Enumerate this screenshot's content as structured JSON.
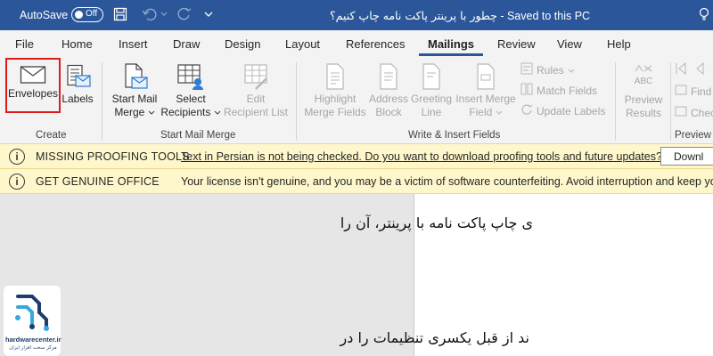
{
  "titlebar": {
    "autosave_label": "AutoSave",
    "autosave_state": "Off",
    "document_title": "چطور با پرینتر پاکت نامه چاپ کنیم؟",
    "separator": " - ",
    "save_status": "Saved to this PC",
    "bg_color": "#2b579a"
  },
  "tabs": [
    "File",
    "Home",
    "Insert",
    "Draw",
    "Design",
    "Layout",
    "References",
    "Mailings",
    "Review",
    "View",
    "Help"
  ],
  "active_tab": "Mailings",
  "ribbon": {
    "create": {
      "envelopes": "Envelopes",
      "labels": "Labels",
      "group": "Create"
    },
    "start_mail_merge": {
      "start_mail_merge_l1": "Start Mail",
      "start_mail_merge_l2": "Merge",
      "select_recipients_l1": "Select",
      "select_recipients_l2": "Recipients",
      "edit_recipient_list_l1": "Edit",
      "edit_recipient_list_l2": "Recipient List",
      "group": "Start Mail Merge"
    },
    "write_insert": {
      "highlight_l1": "Highlight",
      "highlight_l2": "Merge Fields",
      "address_l1": "Address",
      "address_l2": "Block",
      "greeting_l1": "Greeting",
      "greeting_l2": "Line",
      "insert_merge_l1": "Insert Merge",
      "insert_merge_l2": "Field",
      "rules": "Rules",
      "match_fields": "Match Fields",
      "update_labels": "Update Labels",
      "group": "Write & Insert Fields"
    },
    "preview": {
      "preview_results_icon_text": "ABC",
      "preview_l1": "Preview",
      "preview_l2": "Results",
      "find": "Find",
      "check": "Chec",
      "group": "Preview"
    },
    "highlight_color": "#e11a1a"
  },
  "messages": [
    {
      "title": "MISSING PROOFING TOOLS",
      "text": "Text in Persian is not being checked. Do you want to download proofing tools and future updates?",
      "button": "Downl"
    },
    {
      "title": "GET GENUINE OFFICE",
      "text": "Your license isn't genuine, and you may be a victim of software counterfeiting. Avoid interruption and keep your f"
    }
  ],
  "document": {
    "line1": "ی چاپ پاکت نامه با پرینتر، آن را",
    "line2": "ند از قبل یکسری تنظیمات را در"
  },
  "watermark": {
    "site": "hardwarecenter.ir",
    "subtitle": "مرکز سخت افزار ایران"
  }
}
